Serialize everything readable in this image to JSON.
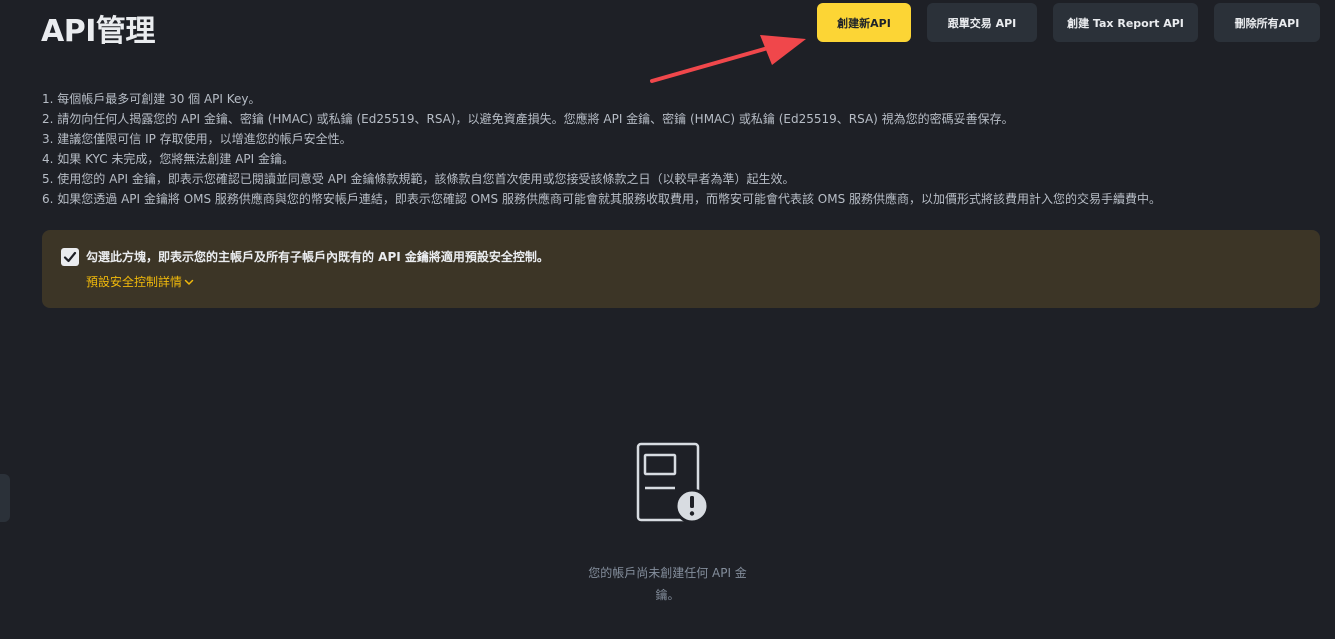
{
  "page": {
    "title": "API管理"
  },
  "toolbar": {
    "create_label": "創建新API",
    "copy_trade_label": "跟單交易 API",
    "tax_report_label": "創建 Tax Report API",
    "delete_all_label": "刪除所有API"
  },
  "notes": [
    "1. 每個帳戶最多可創建 30 個 API Key。",
    "2. 請勿向任何人揭露您的 API 金鑰、密鑰 (HMAC) 或私鑰 (Ed25519、RSA)，以避免資產損失。您應將 API 金鑰、密鑰 (HMAC) 或私鑰 (Ed25519、RSA) 視為您的密碼妥善保存。",
    "3. 建議您僅限可信 IP 存取使用，以增進您的帳戶安全性。",
    "4. 如果 KYC 未完成，您將無法創建 API 金鑰。",
    "5. 使用您的 API 金鑰，即表示您確認已閱讀並同意受 API 金鑰條款規範，該條款自您首次使用或您接受該條款之日（以較早者為準）起生效。",
    "6. 如果您透過 API 金鑰將 OMS 服務供應商與您的幣安帳戶連結，即表示您確認 OMS 服務供應商可能會就其服務收取費用，而幣安可能會代表該 OMS 服務供應商，以加價形式將該費用計入您的交易手續費中。"
  ],
  "consent": {
    "checked": true,
    "text": "勾選此方塊，即表示您的主帳戶及所有子帳戶內既有的 API 金鑰將適用預設安全控制。",
    "details_link": "預設安全控制詳情"
  },
  "empty_state": {
    "message": "您的帳戶尚未創建任何 API 金鑰。",
    "icon": "document-warning-icon"
  },
  "colors": {
    "background": "#1e2026",
    "accent": "#fcd535",
    "link": "#f0b90b",
    "annotation_arrow": "#f0474b"
  }
}
